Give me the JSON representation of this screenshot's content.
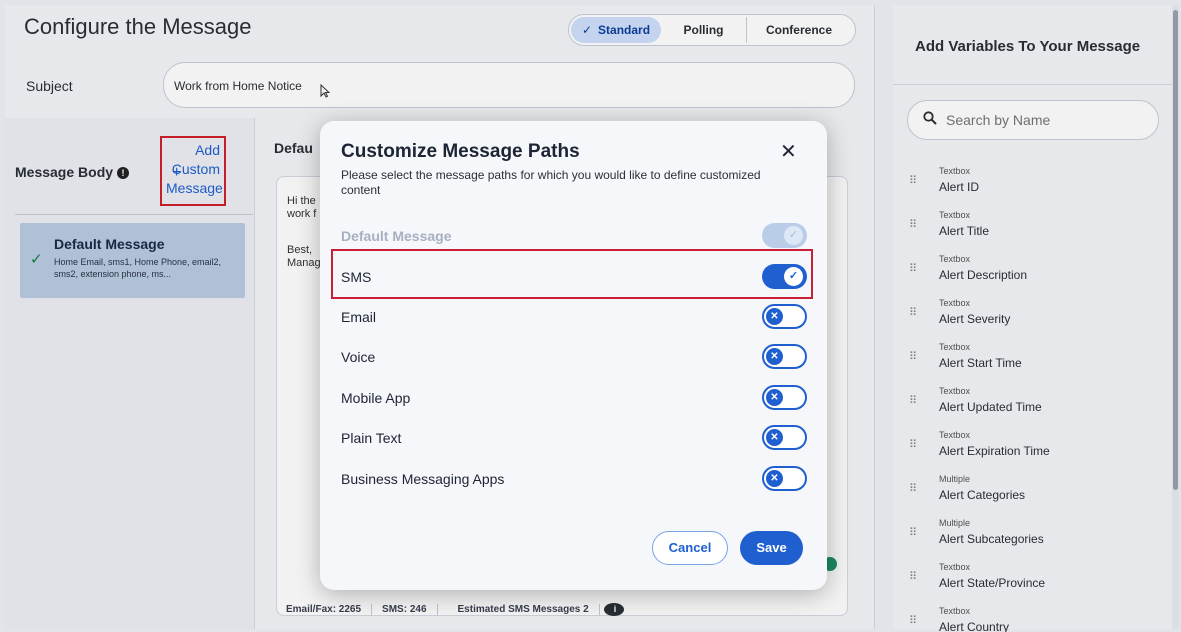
{
  "page": {
    "title": "Configure the Message",
    "modes": [
      {
        "label": "Standard",
        "icon": "check-icon",
        "active": true
      },
      {
        "label": "Polling",
        "active": false
      },
      {
        "label": "Conference",
        "active": false
      }
    ],
    "subject_label": "Subject",
    "subject_value": "Work from Home Notice"
  },
  "message_body": {
    "title": "Message Body",
    "info_icon": "info-icon",
    "add_line1": "Add",
    "add_plus": "+",
    "add_line2": "Custom",
    "add_line3": "Message",
    "default_card": {
      "title": "Default Message",
      "paths": "Home Email, sms1, Home Phone, email2, sms2, extension phone, ms..."
    }
  },
  "editor": {
    "title": "Defau",
    "line1": "Hi the",
    "line2": "work f",
    "line3": "Best,",
    "line4": "Manag",
    "footer": {
      "email_fax": "Email/Fax: 2265",
      "sms": "SMS: 246",
      "estimated": "Estimated SMS Messages 2"
    }
  },
  "variables": {
    "title": "Add Variables To Your Message",
    "search_placeholder": "Search by Name",
    "items": [
      {
        "kind": "Textbox",
        "name": "Alert ID"
      },
      {
        "kind": "Textbox",
        "name": "Alert Title"
      },
      {
        "kind": "Textbox",
        "name": "Alert Description"
      },
      {
        "kind": "Textbox",
        "name": "Alert Severity"
      },
      {
        "kind": "Textbox",
        "name": "Alert Start Time"
      },
      {
        "kind": "Textbox",
        "name": "Alert Updated Time"
      },
      {
        "kind": "Textbox",
        "name": "Alert Expiration Time"
      },
      {
        "kind": "Multiple",
        "name": "Alert Categories"
      },
      {
        "kind": "Multiple",
        "name": "Alert Subcategories"
      },
      {
        "kind": "Textbox",
        "name": "Alert State/Province"
      },
      {
        "kind": "Textbox",
        "name": "Alert Country"
      }
    ]
  },
  "dialog": {
    "title": "Customize Message Paths",
    "close_glyph": "✕",
    "description": "Please select the message paths for which you would like to define customized content",
    "paths": [
      {
        "label": "Default Message",
        "state": "disabled"
      },
      {
        "label": "SMS",
        "state": "on"
      },
      {
        "label": "Email",
        "state": "off"
      },
      {
        "label": "Voice",
        "state": "off"
      },
      {
        "label": "Mobile App",
        "state": "off"
      },
      {
        "label": "Plain Text",
        "state": "off"
      },
      {
        "label": "Business Messaging Apps",
        "state": "off"
      }
    ],
    "cancel_label": "Cancel",
    "save_label": "Save"
  },
  "colors": {
    "accent": "#1f5fcf",
    "highlight_border": "#c91f36"
  }
}
